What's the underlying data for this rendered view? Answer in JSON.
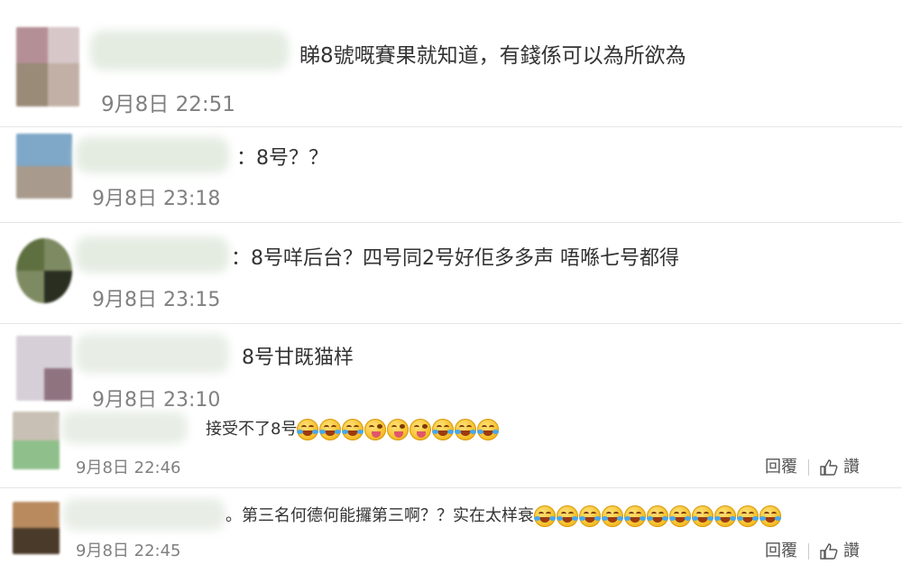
{
  "comments": [
    {
      "text": "睇8號嘅賽果就知道，有錢係可以為所欲為",
      "time": "9月8日 22:51"
    },
    {
      "text": "：8号？？",
      "time": "9月8日 23:18"
    },
    {
      "text": "：8号咩后台？四号同2号好佢多多声 唔喺七号都得",
      "time": "9月8日 23:15"
    },
    {
      "text": "8号甘既猫样",
      "time": "9月8日 23:10"
    },
    {
      "text": "接受不了8号",
      "time": "9月8日 22:46",
      "reply_label": "回覆",
      "like_label": "讚"
    },
    {
      "text": "。第三名何德何能攞第三啊？？实在太样衰",
      "time": "9月8日 22:45",
      "reply_label": "回覆",
      "like_label": "讚"
    }
  ],
  "emojis": {
    "comment5": [
      "laugh-cry",
      "laugh-cry",
      "laugh-cry",
      "yum",
      "yum",
      "yum",
      "rofl",
      "rofl",
      "rofl"
    ],
    "comment6": [
      "rofl",
      "rofl",
      "rofl",
      "rofl",
      "rofl",
      "rofl",
      "rofl",
      "rofl",
      "rofl",
      "rofl",
      "rofl"
    ]
  },
  "colors": {
    "text": "#333333",
    "time": "#808080",
    "divider": "#e6e6e6"
  }
}
